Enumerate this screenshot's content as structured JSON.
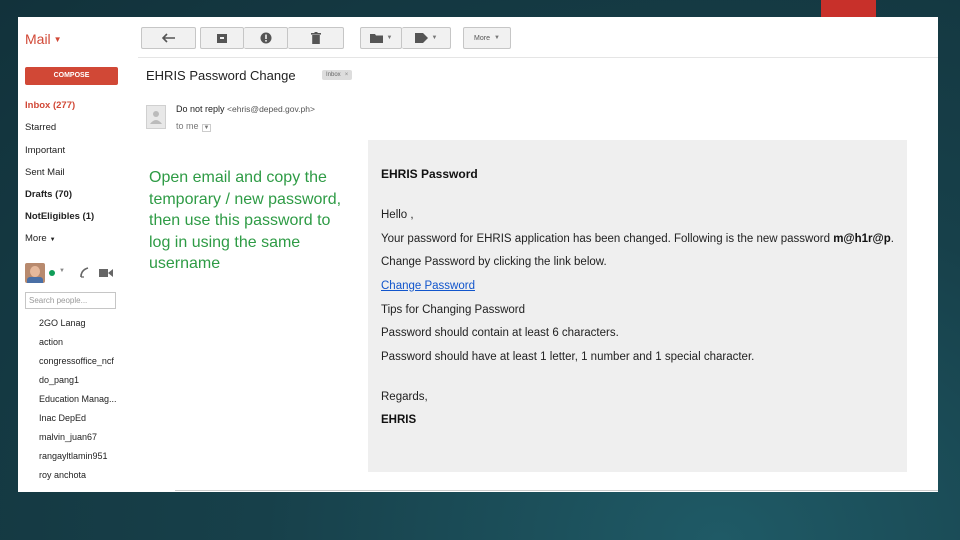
{
  "app": {
    "title": "Mail"
  },
  "toolbar": {
    "more_label": "More"
  },
  "sidebar": {
    "compose_label": "COMPOSE",
    "items": [
      {
        "label": "Inbox (277)"
      },
      {
        "label": "Starred"
      },
      {
        "label": "Important"
      },
      {
        "label": "Sent Mail"
      },
      {
        "label": "Drafts (70)"
      },
      {
        "label": "NotEligibles (1)"
      },
      {
        "label": "More"
      }
    ],
    "search_placeholder": "Search people...",
    "contacts": [
      "2GO Lanag",
      "action",
      "congressoffice_ncf",
      "do_pang1",
      "Education Manag...",
      "Inac DepEd",
      "malvin_juan67",
      "rangayltlamin951",
      "roy anchota"
    ]
  },
  "email": {
    "subject": "EHRIS Password Change",
    "label": "Inbox",
    "sender_name": "Do not reply",
    "sender_address": "<ehris@deped.gov.ph>",
    "to_line": "to me"
  },
  "instruction": "Open email and copy the temporary / new password, then use this password to log in using the same username",
  "message": {
    "heading": "EHRIS Password",
    "greeting": "Hello ,",
    "line1": "Your password for EHRIS application has been changed. Following is the new password",
    "new_password": "m@h1r@p",
    "line2": "Change Password by clicking the link below.",
    "link": "Change Password",
    "tips": "Tips for Changing Password",
    "tip1": "Password should contain at least 6 characters.",
    "tip2": "Password should have at least 1 letter, 1 number and 1 special character.",
    "regards": "Regards,",
    "signature": "EHRIS"
  },
  "colors": {
    "brand_red": "#d14836",
    "instruction_green": "#2e9b45",
    "link_blue": "#1155cc",
    "background": "#17404a"
  }
}
